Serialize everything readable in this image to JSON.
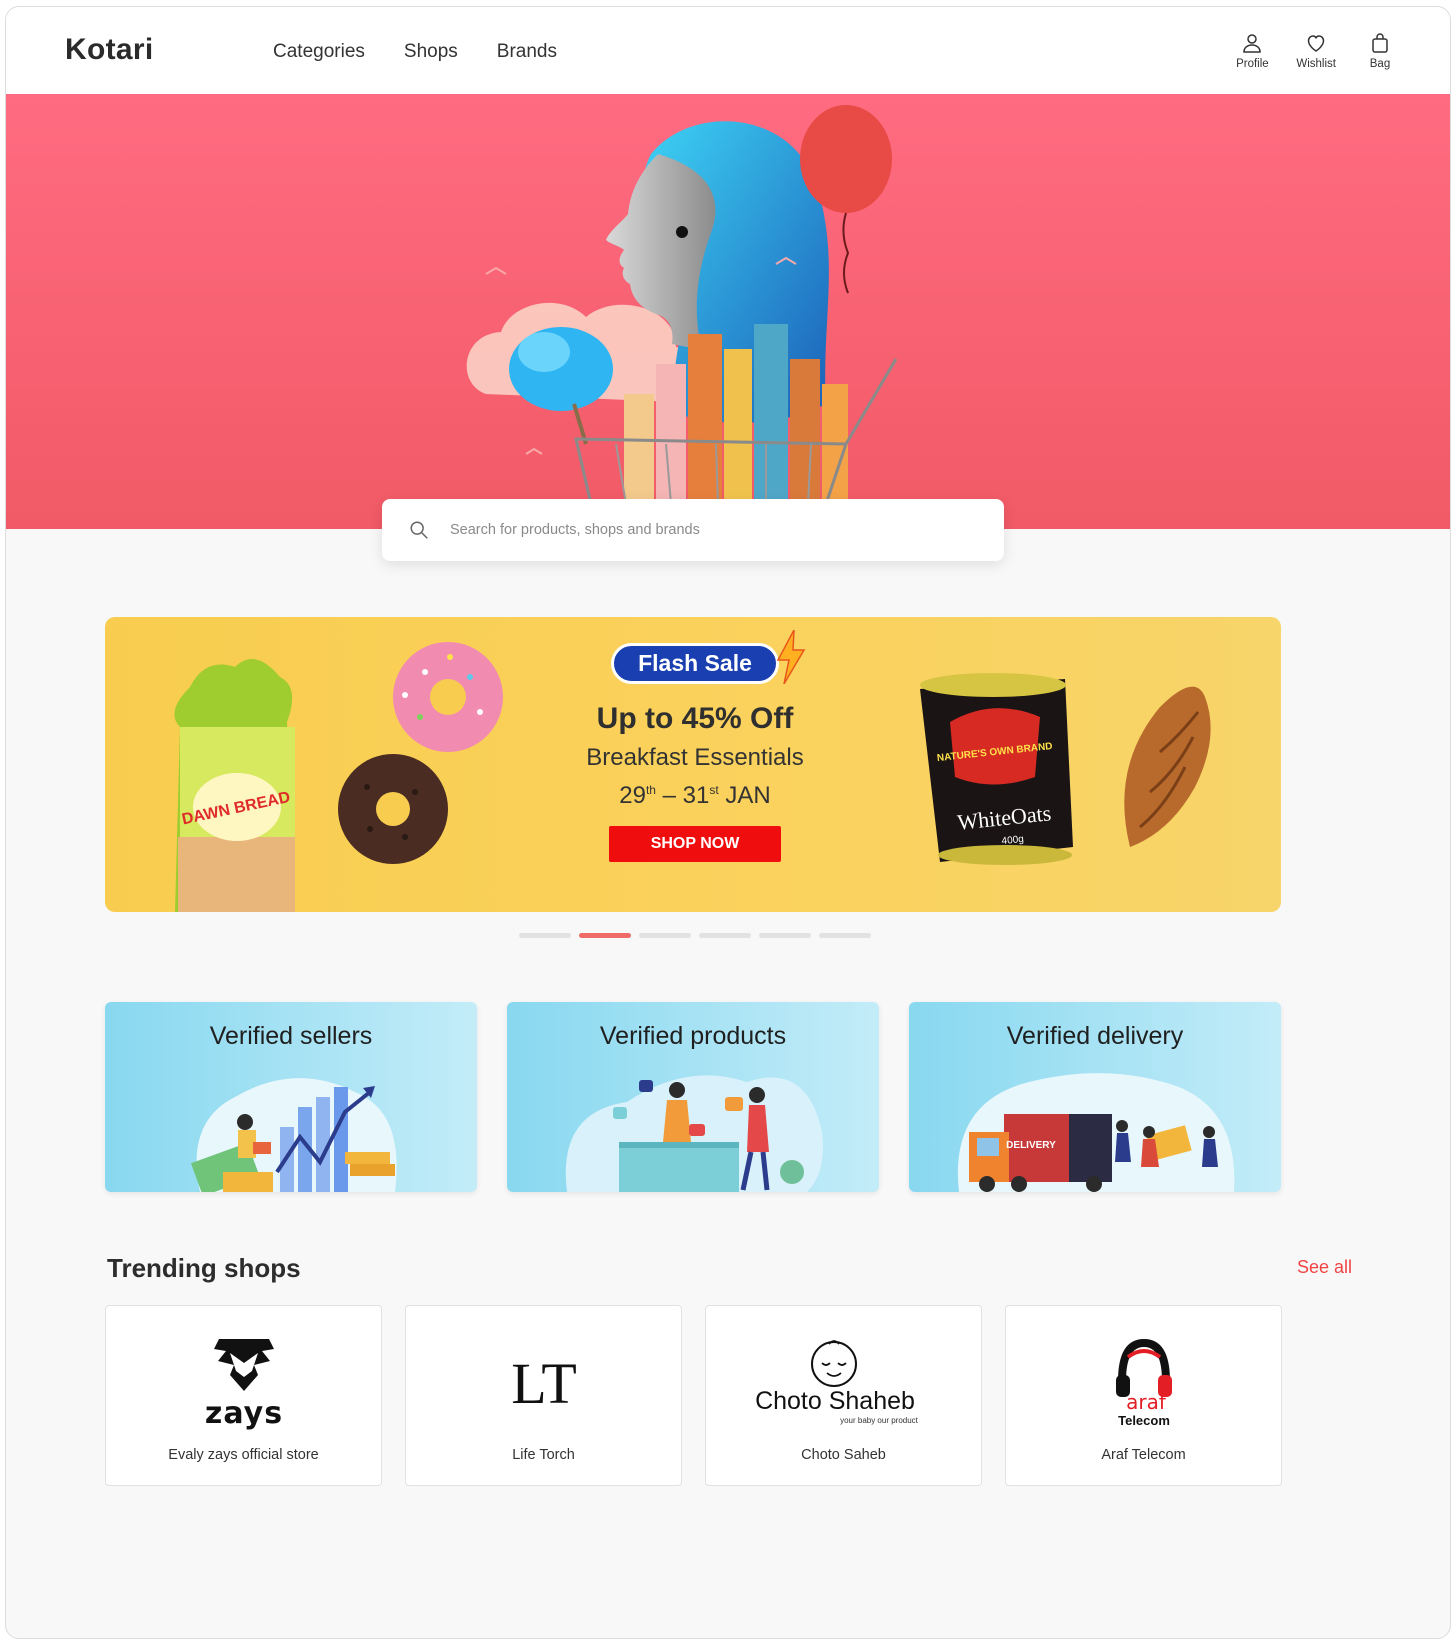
{
  "app": {
    "logo": "Kotari"
  },
  "nav": {
    "links": [
      "Categories",
      "Shops",
      "Brands"
    ],
    "icons": [
      {
        "name": "profile-icon",
        "label": "Profile"
      },
      {
        "name": "wishlist-icon",
        "label": "Wishlist"
      },
      {
        "name": "bag-icon",
        "label": "Bag"
      }
    ]
  },
  "search": {
    "placeholder": "Search for products, shops and brands"
  },
  "promo": {
    "badge": "Flash Sale",
    "headline": "Up to 45% Off",
    "subtitle": "Breakfast Essentials",
    "date_start": "29",
    "date_start_sup": "th",
    "date_sep": " – ",
    "date_end": "31",
    "date_end_sup": "st",
    "date_month": " JAN",
    "cta": "SHOP NOW",
    "product_left": "DAWN BREAD",
    "product_right_brand": "NATURE'S OWN BRAND",
    "product_right_name": "WhiteOats",
    "product_right_weight": "400g"
  },
  "carousel": {
    "count": 6,
    "active_index": 1
  },
  "features": [
    {
      "title": "Verified sellers"
    },
    {
      "title": "Verified products"
    },
    {
      "title": "Verified delivery",
      "truck_label": "DELIVERY"
    }
  ],
  "trending": {
    "title": "Trending shops",
    "see_all": "See all",
    "shops": [
      {
        "name": "Evaly zays official store",
        "logo_text": "zays"
      },
      {
        "name": "Life Torch",
        "logo_text": "LT"
      },
      {
        "name": "Choto Saheb",
        "logo_text": "Choto Shaheb",
        "logo_tagline": "your baby our product"
      },
      {
        "name": "Araf Telecom",
        "logo_text": "araf",
        "logo_sub": "Telecom"
      }
    ]
  },
  "colors": {
    "hero": "#ff6b81",
    "promo": "#f8cd4f",
    "accent": "#f04444",
    "cta": "#f00d0d",
    "flash": "#1a3fb0"
  }
}
